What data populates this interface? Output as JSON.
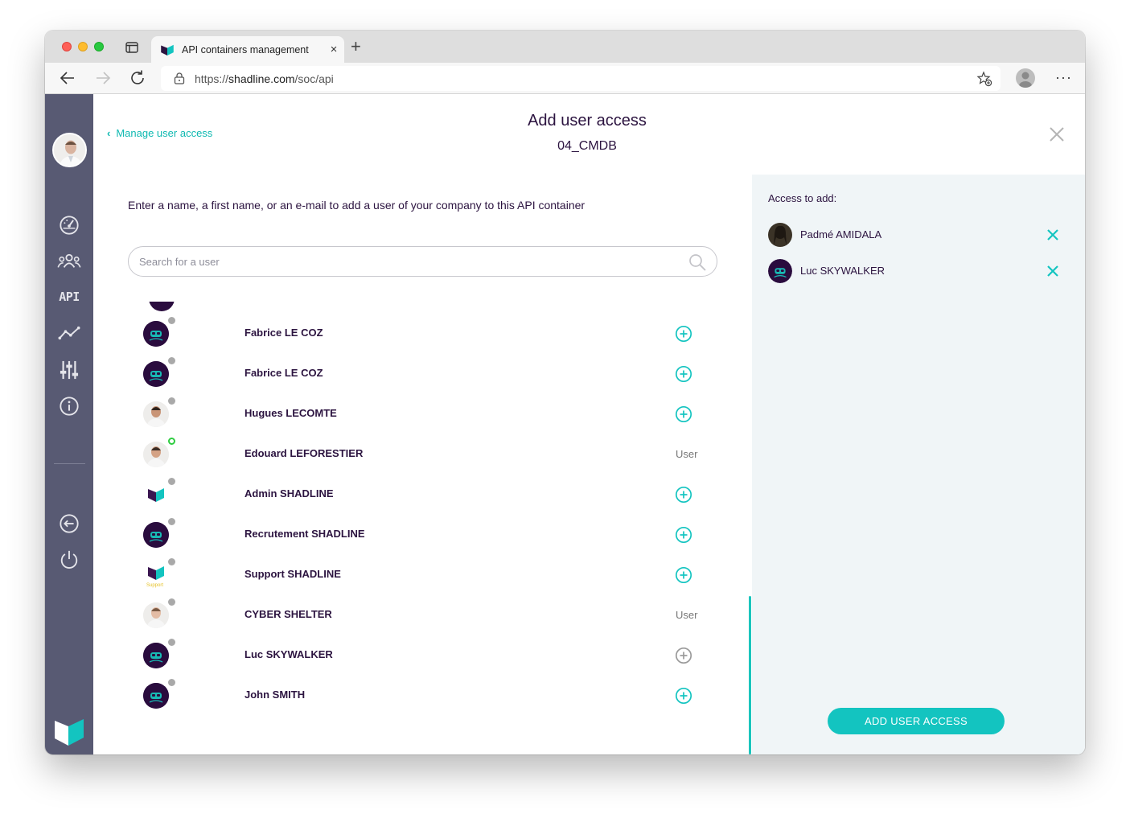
{
  "browser": {
    "tab_title": "API containers management",
    "tab_close": "×",
    "new_tab": "+",
    "url_prefix": "https://",
    "url_domain": "shadline.com",
    "url_path": "/soc/api",
    "more": "···"
  },
  "sidebar": {
    "items": [
      "dashboard-icon",
      "users-icon",
      "api",
      "analytics-icon",
      "settings-sliders-icon",
      "info-icon",
      "back-icon",
      "power-icon"
    ],
    "api_label": "API"
  },
  "header": {
    "back_label": "Manage user access",
    "title": "Add user access",
    "subtitle": "04_CMDB"
  },
  "instructions": "Enter a name, a first name, or an e-mail to add a user of your company to this API container",
  "search": {
    "placeholder": "Search for a user"
  },
  "users": [
    {
      "name": "Fabrice LE COZ",
      "avatar": "dark",
      "status": "offline",
      "action": "add",
      "role": ""
    },
    {
      "name": "Fabrice LE COZ",
      "avatar": "dark",
      "status": "offline",
      "action": "add",
      "role": ""
    },
    {
      "name": "Hugues LECOMTE",
      "avatar": "photo",
      "status": "offline",
      "action": "add",
      "role": ""
    },
    {
      "name": "Edouard LEFORESTIER",
      "avatar": "photo",
      "status": "online",
      "action": "role",
      "role": "User"
    },
    {
      "name": "Admin SHADLINE",
      "avatar": "logo",
      "status": "offline",
      "action": "add",
      "role": ""
    },
    {
      "name": "Recrutement SHADLINE",
      "avatar": "dark",
      "status": "offline",
      "action": "add",
      "role": ""
    },
    {
      "name": "Support SHADLINE",
      "avatar": "support-logo",
      "status": "offline",
      "action": "add",
      "role": ""
    },
    {
      "name": "CYBER SHELTER",
      "avatar": "photo",
      "status": "offline",
      "action": "role",
      "role": "User"
    },
    {
      "name": "Luc SKYWALKER",
      "avatar": "dark",
      "status": "offline",
      "action": "added",
      "role": ""
    },
    {
      "name": "John SMITH",
      "avatar": "dark",
      "status": "offline",
      "action": "add",
      "role": ""
    }
  ],
  "support_logo_text": "Support",
  "panel": {
    "title": "Access to add:",
    "selected": [
      {
        "name": "Padmé AMIDALA",
        "avatar": "photo"
      },
      {
        "name": "Luc SKYWALKER",
        "avatar": "dark"
      }
    ],
    "submit_label": "ADD USER ACCESS"
  },
  "colors": {
    "accent": "#13c4c0",
    "sidebar": "#585a73",
    "text": "#2c1440",
    "panel_bg": "#f0f5f7",
    "avatar_dark": "#2a0c3e",
    "online": "#2ecc40"
  }
}
